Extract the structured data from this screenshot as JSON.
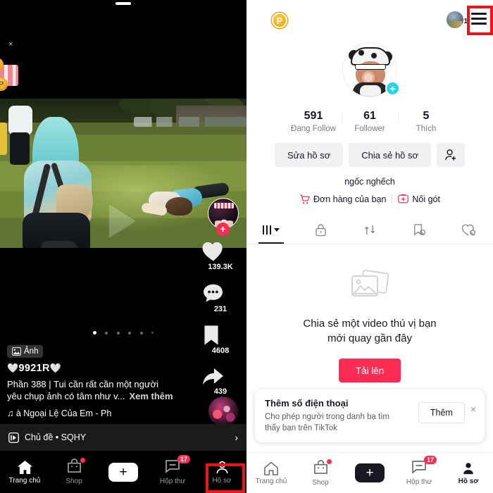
{
  "feed": {
    "close_icon_label": "×",
    "coin_badge_text": "P",
    "photo_tag": "Ảnh",
    "handle": "9921R",
    "heart_left": "🤍",
    "heart_right": "🤍",
    "caption_line1": "Phần 388 | Tui cần rất cần một người",
    "caption_line2": "yêu chụp ảnh có tâm như v...",
    "see_more": "Xem thêm",
    "music": "♫ à Ngoại Lệ Của Em - Ph",
    "topic": "Chủ đề • SQHY",
    "chevron": "›",
    "actions": {
      "like_count": "139.3K",
      "comment_count": "231",
      "bookmark_count": "4608",
      "share_count": "439",
      "follow_plus": "+"
    },
    "carousel": {
      "total": 6,
      "active_index": 0
    }
  },
  "nav_dark": {
    "items": [
      {
        "label": "Trang chủ",
        "icon": "home-icon",
        "active": true,
        "badge": ""
      },
      {
        "label": "Shop",
        "icon": "shop-icon",
        "active": false,
        "badge": "dot"
      },
      {
        "label": "",
        "icon": "plus-icon",
        "active": false,
        "badge": ""
      },
      {
        "label": "Hộp thư",
        "icon": "inbox-icon",
        "active": false,
        "badge": "17"
      },
      {
        "label": "Hồ sơ",
        "icon": "profile-icon",
        "active": false,
        "badge": ""
      }
    ],
    "plus_glyph": "+"
  },
  "profile": {
    "p_badge": "P",
    "mini_avatar_count": "1",
    "avatar_plus": "+",
    "stats": [
      {
        "value": "591",
        "label": "Đang Follow"
      },
      {
        "value": "61",
        "label": "Follower"
      },
      {
        "value": "5",
        "label": "Thích"
      }
    ],
    "edit_button": "Sửa hồ sơ",
    "share_button": "Chia sẻ hồ sơ",
    "add_user_icon": "add-person-icon",
    "bio": "ngốc nghếch",
    "links": [
      {
        "label": "Đơn hàng của bạn",
        "icon": "cart-icon"
      },
      {
        "label": "Nối gót",
        "icon": "first-aid-icon"
      }
    ],
    "tabs": [
      {
        "icon": "grid-icon",
        "active": true
      },
      {
        "icon": "lock-icon",
        "active": false
      },
      {
        "icon": "repost-icon",
        "active": false
      },
      {
        "icon": "bookmark-off-icon",
        "active": false
      },
      {
        "icon": "heart-off-icon",
        "active": false
      }
    ],
    "empty": {
      "icon": "photo-stack-icon",
      "line1": "Chia sẻ một video thú vị bạn",
      "line2": "mới quay gần đây",
      "upload_button": "Tải lên"
    },
    "toast": {
      "title": "Thêm số điện thoại",
      "sub_line1": "Cho phép người trong danh bạ tìm",
      "sub_line2": "thấy bạn trên TikTok",
      "action": "Thêm",
      "close": "×"
    }
  },
  "nav_light": {
    "items": [
      {
        "label": "Trang chủ",
        "icon": "home-icon",
        "active": false,
        "badge": ""
      },
      {
        "label": "Shop",
        "icon": "shop-icon",
        "active": false,
        "badge": "dot"
      },
      {
        "label": "",
        "icon": "plus-icon",
        "active": false,
        "badge": ""
      },
      {
        "label": "Hộp thư",
        "icon": "inbox-icon",
        "active": false,
        "badge": "17"
      },
      {
        "label": "Hồ sơ",
        "icon": "profile-icon",
        "active": true,
        "badge": ""
      }
    ],
    "plus_glyph": "+"
  },
  "colors": {
    "accent_red": "#fe2c55",
    "highlight_box": "#e8161b",
    "cyan": "#20d5ec",
    "grey_button": "#f1f1f2",
    "text_primary": "#161823"
  },
  "highlights": [
    {
      "name": "hamburger-menu-highlight"
    },
    {
      "name": "profile-tab-highlight"
    }
  ]
}
